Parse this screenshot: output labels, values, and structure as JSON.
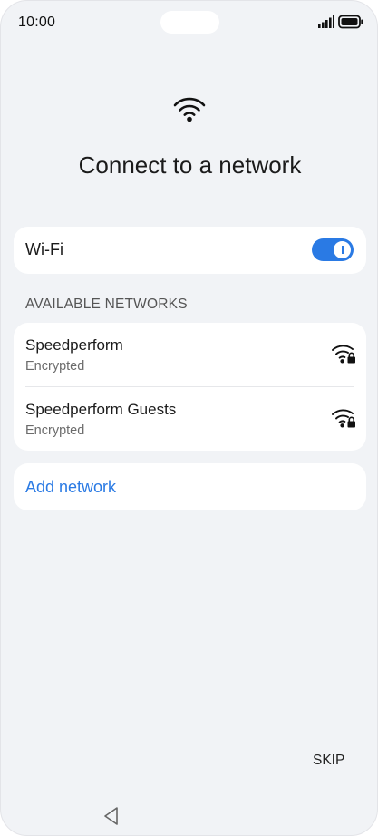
{
  "status_bar": {
    "time": "10:00",
    "signal_icon": "signal-bars-icon",
    "battery_icon": "battery-full-icon"
  },
  "header": {
    "icon": "wifi-icon",
    "title": "Connect to a network"
  },
  "wifi_toggle": {
    "label": "Wi-Fi",
    "state": "on"
  },
  "available_networks": {
    "header": "AVAILABLE NETWORKS",
    "items": [
      {
        "name": "Speedperform",
        "security": "Encrypted",
        "icon": "wifi-lock-icon"
      },
      {
        "name": "Speedperform Guests",
        "security": "Encrypted",
        "icon": "wifi-lock-icon"
      }
    ]
  },
  "add_network": {
    "label": "Add network"
  },
  "footer": {
    "skip_label": "SKIP",
    "back_icon": "back-triangle-icon"
  },
  "colors": {
    "accent": "#2a7ae4",
    "background": "#f1f3f6",
    "card": "#ffffff"
  }
}
